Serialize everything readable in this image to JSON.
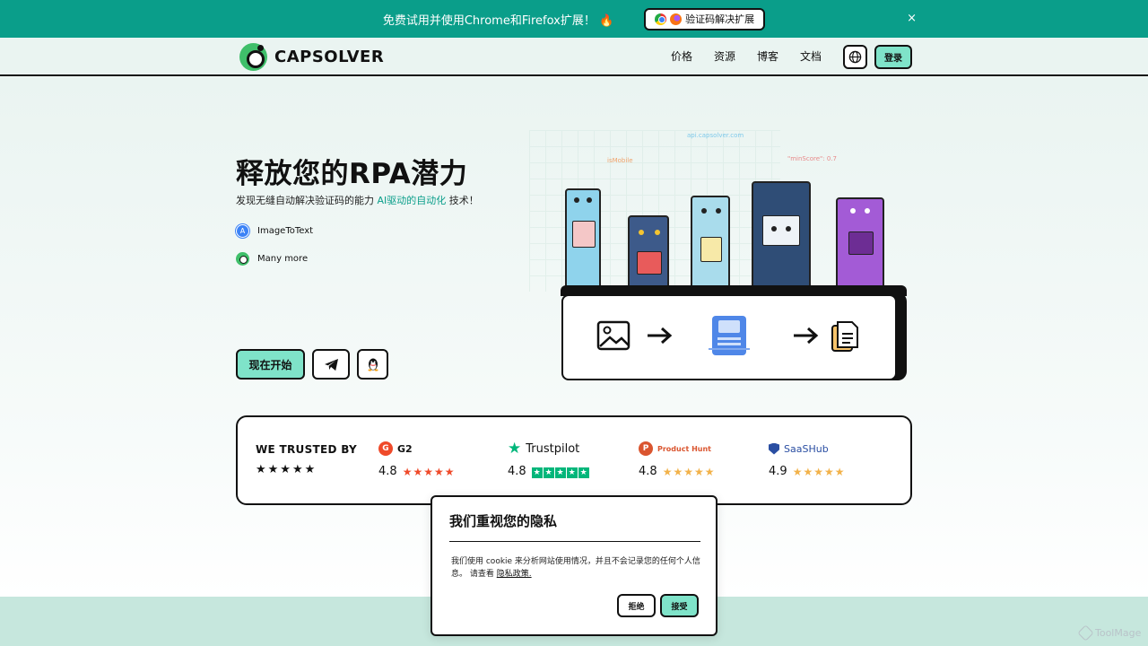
{
  "banner": {
    "message": "免费试用并使用Chrome和Firefox扩展！ 🔥",
    "extension_button": "验证码解决扩展",
    "close": "×"
  },
  "header": {
    "logo_text": "CAPSOLVER",
    "nav": [
      "价格",
      "资源",
      "博客",
      "文档"
    ],
    "login": "登录"
  },
  "hero": {
    "title": "释放您的RPA潜力",
    "subtitle_before": "发现无缝自动解决验证码的能力 ",
    "subtitle_highlight": "AI驱动的自动化",
    "subtitle_after": " 技术！",
    "features": [
      {
        "label": "ImageToText",
        "icon": "image-to-text-icon"
      },
      {
        "label": "Many more",
        "icon": "capsolver-logo-icon"
      }
    ],
    "cta_start": "现在开始",
    "accent_color": "#7fe3c9",
    "brand_color": "#0a9e8a"
  },
  "illustration": {
    "code_labels": [
      "api.capsolver.com",
      "isMobile",
      "\"minScore\": 0.7"
    ]
  },
  "trust": {
    "title": "WE TRUSTED BY",
    "stars": "★★★★★",
    "reviews": [
      {
        "name": "G2",
        "score": "4.8",
        "stars": "★★★★★"
      },
      {
        "name": "Trustpilot",
        "score": "4.8",
        "stars": "★★★★★"
      },
      {
        "name": "Product Hunt",
        "score": "4.8",
        "stars": "★★★★★"
      },
      {
        "name": "SaaSHub",
        "score": "4.9",
        "stars": "★★★★★"
      }
    ]
  },
  "cookie": {
    "title": "我们重视您的隐私",
    "text": "我们使用 cookie 来分析网站使用情况，并且不会记录您的任何个人信息。 请查看 ",
    "policy_link": "隐私政策.",
    "reject": "拒绝",
    "accept": "接受"
  },
  "watermark": "ToolMage"
}
